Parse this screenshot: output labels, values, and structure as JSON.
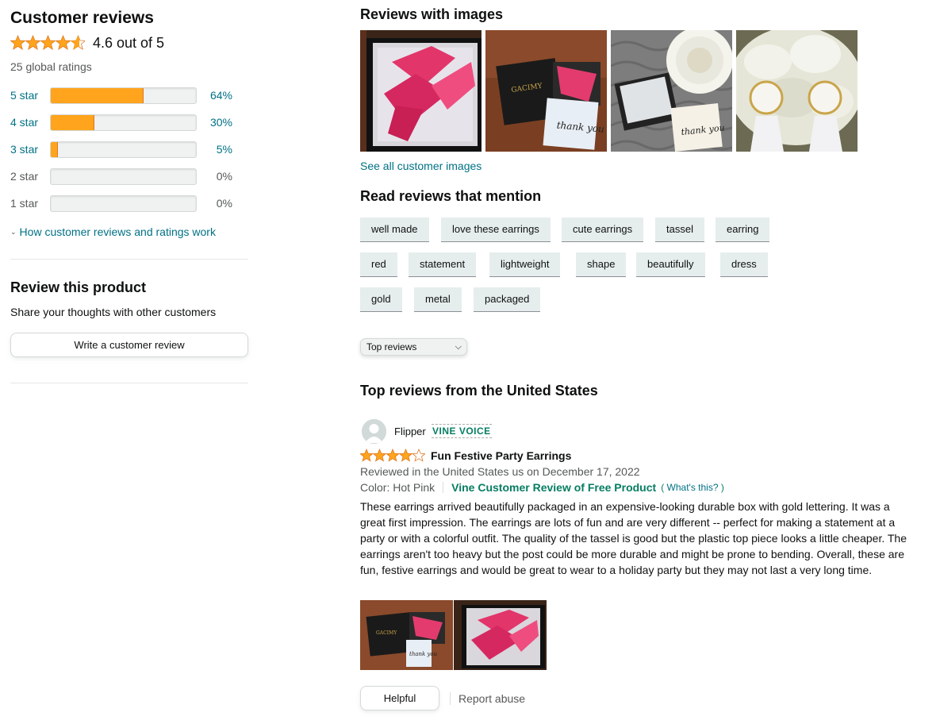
{
  "summary": {
    "heading": "Customer reviews",
    "rating": 4.6,
    "rating_text": "4.6 out of 5",
    "global_ratings": "25 global ratings",
    "histogram": [
      {
        "label": "5 star",
        "percent_text": "64%",
        "percent": 64
      },
      {
        "label": "4 star",
        "percent_text": "30%",
        "percent": 30
      },
      {
        "label": "3 star",
        "percent_text": "5%",
        "percent": 5
      },
      {
        "label": "2 star",
        "percent_text": "0%",
        "percent": 0
      },
      {
        "label": "1 star",
        "percent_text": "0%",
        "percent": 0
      }
    ],
    "how_link": "How customer reviews and ratings work"
  },
  "review_product": {
    "heading": "Review this product",
    "subtext": "Share your thoughts with other customers",
    "button": "Write a customer review"
  },
  "images_section": {
    "heading": "Reviews with images",
    "see_all": "See all customer images"
  },
  "mention": {
    "heading": "Read reviews that mention",
    "chips": [
      "well made",
      "love these earrings",
      "cute earrings",
      "tassel",
      "earring",
      "red",
      "statement",
      "lightweight",
      "shape",
      "beautifully",
      "dress",
      "gold",
      "metal",
      "packaged"
    ]
  },
  "sort": {
    "selected": "Top reviews"
  },
  "top_reviews": {
    "heading": "Top reviews from the United States",
    "review": {
      "reviewer": "Flipper",
      "badge": "VINE VOICE",
      "stars": 4,
      "title": "Fun Festive Party Earrings",
      "date": "Reviewed in the United States us on December 17, 2022",
      "color": "Color: Hot Pink",
      "vine_label": "Vine Customer Review of Free Product",
      "whats_open": "( ",
      "whats_link": "What's this?",
      "whats_close": " )",
      "body": "These earrings arrived beautifully packaged in an expensive-looking durable box with gold lettering. It was a great first impression. The earrings are lots of fun and are very different -- perfect for making a statement at a party or with a colorful outfit. The quality of the tassel is good but the plastic top piece looks a little cheaper. The earrings aren't too heavy but the post could be more durable and might be prone to bending. Overall, these are fun, festive earrings and would be great to wear to a holiday party but they may not last a very long time.",
      "helpful": "Helpful",
      "report": "Report abuse"
    }
  },
  "box_brand": "GACIMY",
  "card_text": "thank you",
  "colors": {
    "star": "#ffa41c",
    "link": "#007185",
    "vine_green": "#067d62"
  }
}
